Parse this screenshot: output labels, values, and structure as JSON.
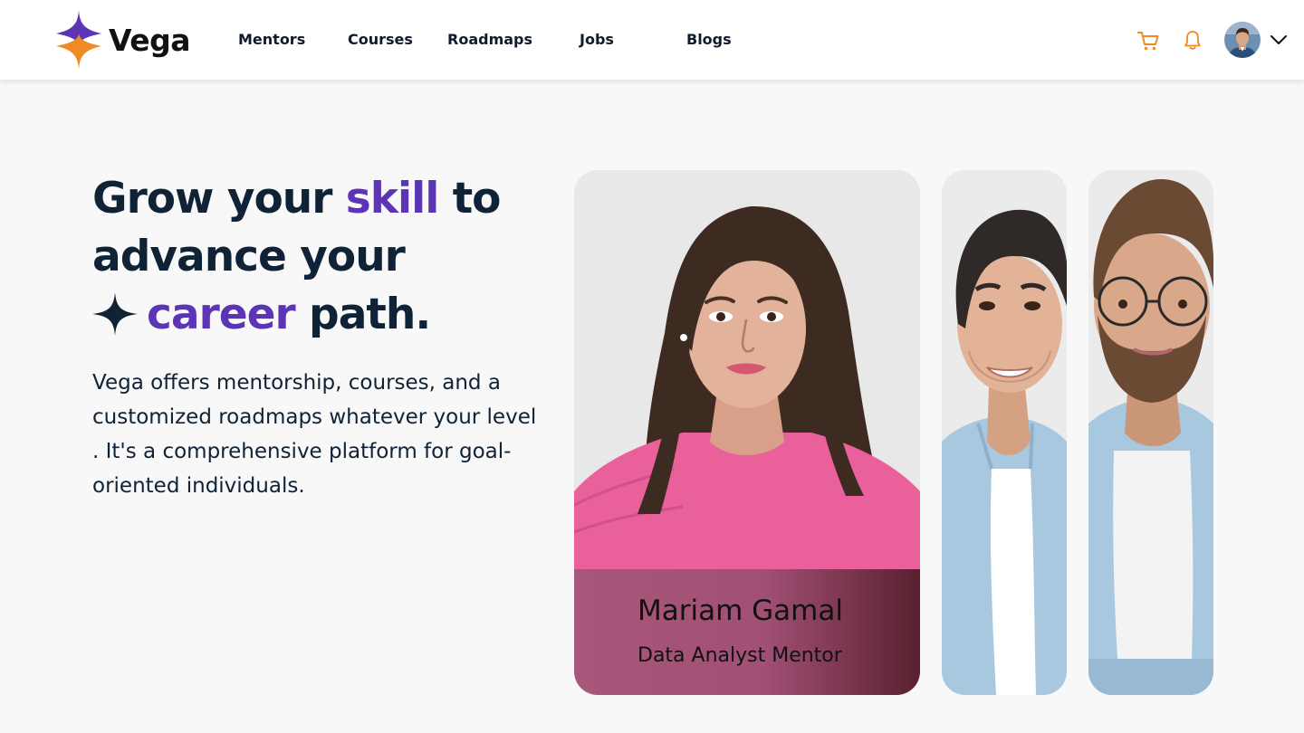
{
  "brand": {
    "name": "Vega",
    "primary_color": "#5b35b5",
    "secondary_color": "#f08a24"
  },
  "nav": {
    "items": [
      {
        "label": "Mentors"
      },
      {
        "label": "Courses"
      },
      {
        "label": "Roadmaps"
      },
      {
        "label": "Jobs"
      },
      {
        "label": "Blogs"
      }
    ]
  },
  "header_actions": {
    "cart_icon": "cart-icon",
    "notification_icon": "bell-icon",
    "profile_menu_icon": "chevron-down-icon"
  },
  "hero": {
    "headline": {
      "part1": "Grow your ",
      "highlight1": "skill",
      "part2": " to advance your",
      "highlight2": "career",
      "part3": " path."
    },
    "description": "Vega offers mentorship, courses, and a customized roadmaps whatever your level . It's a comprehensive platform for goal-oriented individuals."
  },
  "featured_mentor": {
    "name": "Mariam Gamal",
    "role": "Data Analyst Mentor"
  },
  "colors": {
    "text_dark": "#0f2236",
    "background": "#f8f8f8",
    "caption_gradient_start": "#a8577a",
    "caption_gradient_end": "#58212f"
  }
}
